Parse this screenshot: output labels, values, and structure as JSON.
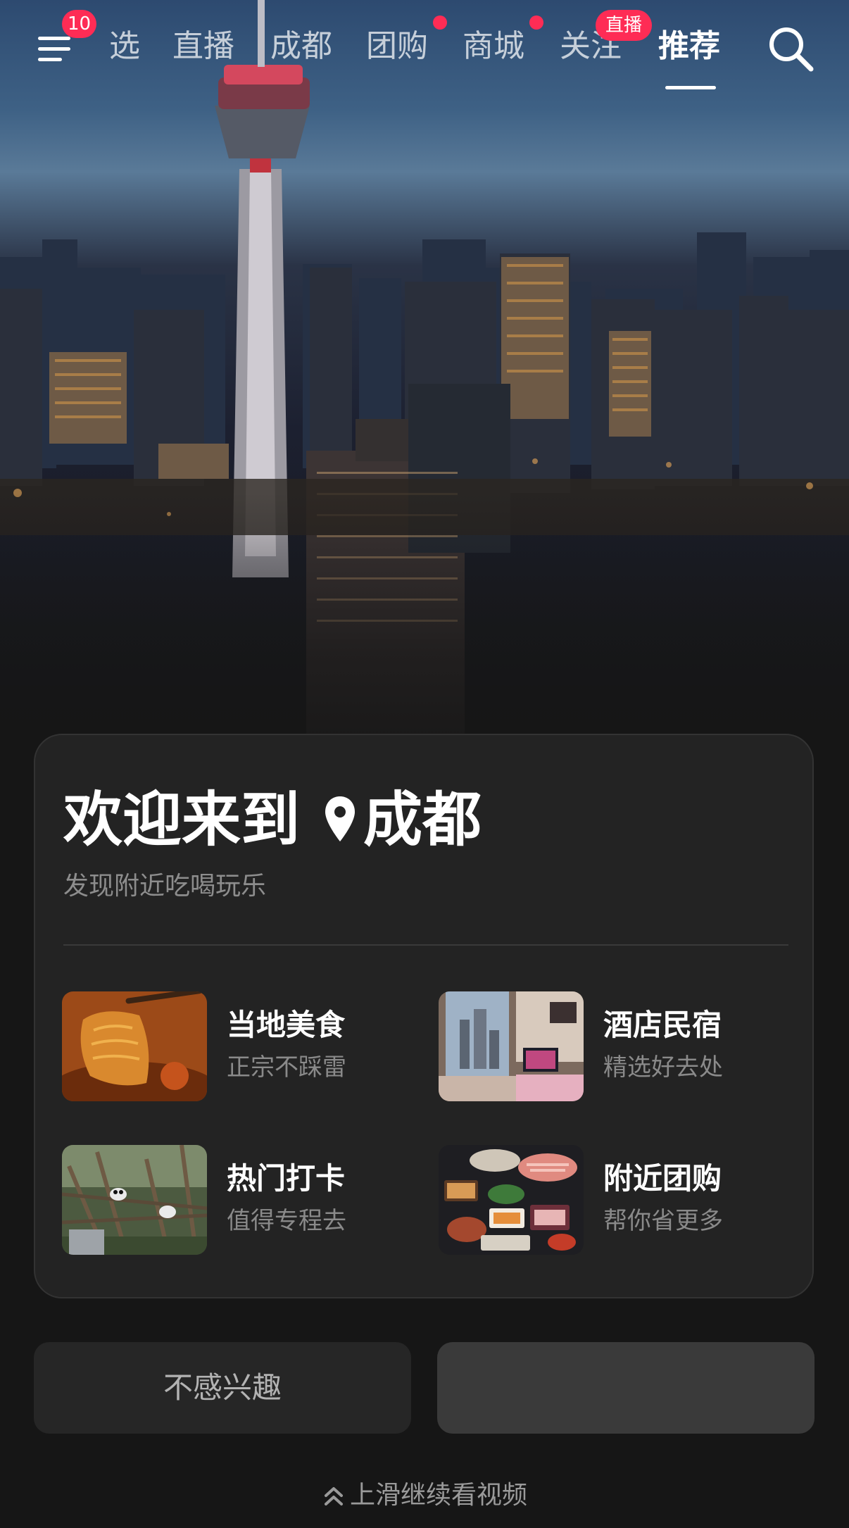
{
  "nav": {
    "menu_badge": "10",
    "tabs": [
      "选",
      "直播",
      "成都",
      "团购",
      "商城",
      "关注",
      "推荐"
    ],
    "active_tab": "推荐",
    "live_badge": "直播"
  },
  "card": {
    "title_prefix": "欢迎来到",
    "city": "成都",
    "subtitle": "发现附近吃喝玩乐",
    "tiles": [
      {
        "title": "当地美食",
        "subtitle": "正宗不踩雷",
        "icon": "food-thumbnail"
      },
      {
        "title": "酒店民宿",
        "subtitle": "精选好去处",
        "icon": "hotel-thumbnail"
      },
      {
        "title": "热门打卡",
        "subtitle": "值得专程去",
        "icon": "panda-thumbnail"
      },
      {
        "title": "附近团购",
        "subtitle": "帮你省更多",
        "icon": "groupbuy-thumbnail"
      }
    ]
  },
  "buttons": {
    "not_interested": "不感兴趣",
    "right": ""
  },
  "hint": "上滑继续看视频",
  "colors": {
    "accent": "#fe2c55",
    "background": "#161616",
    "card": "#232323"
  }
}
